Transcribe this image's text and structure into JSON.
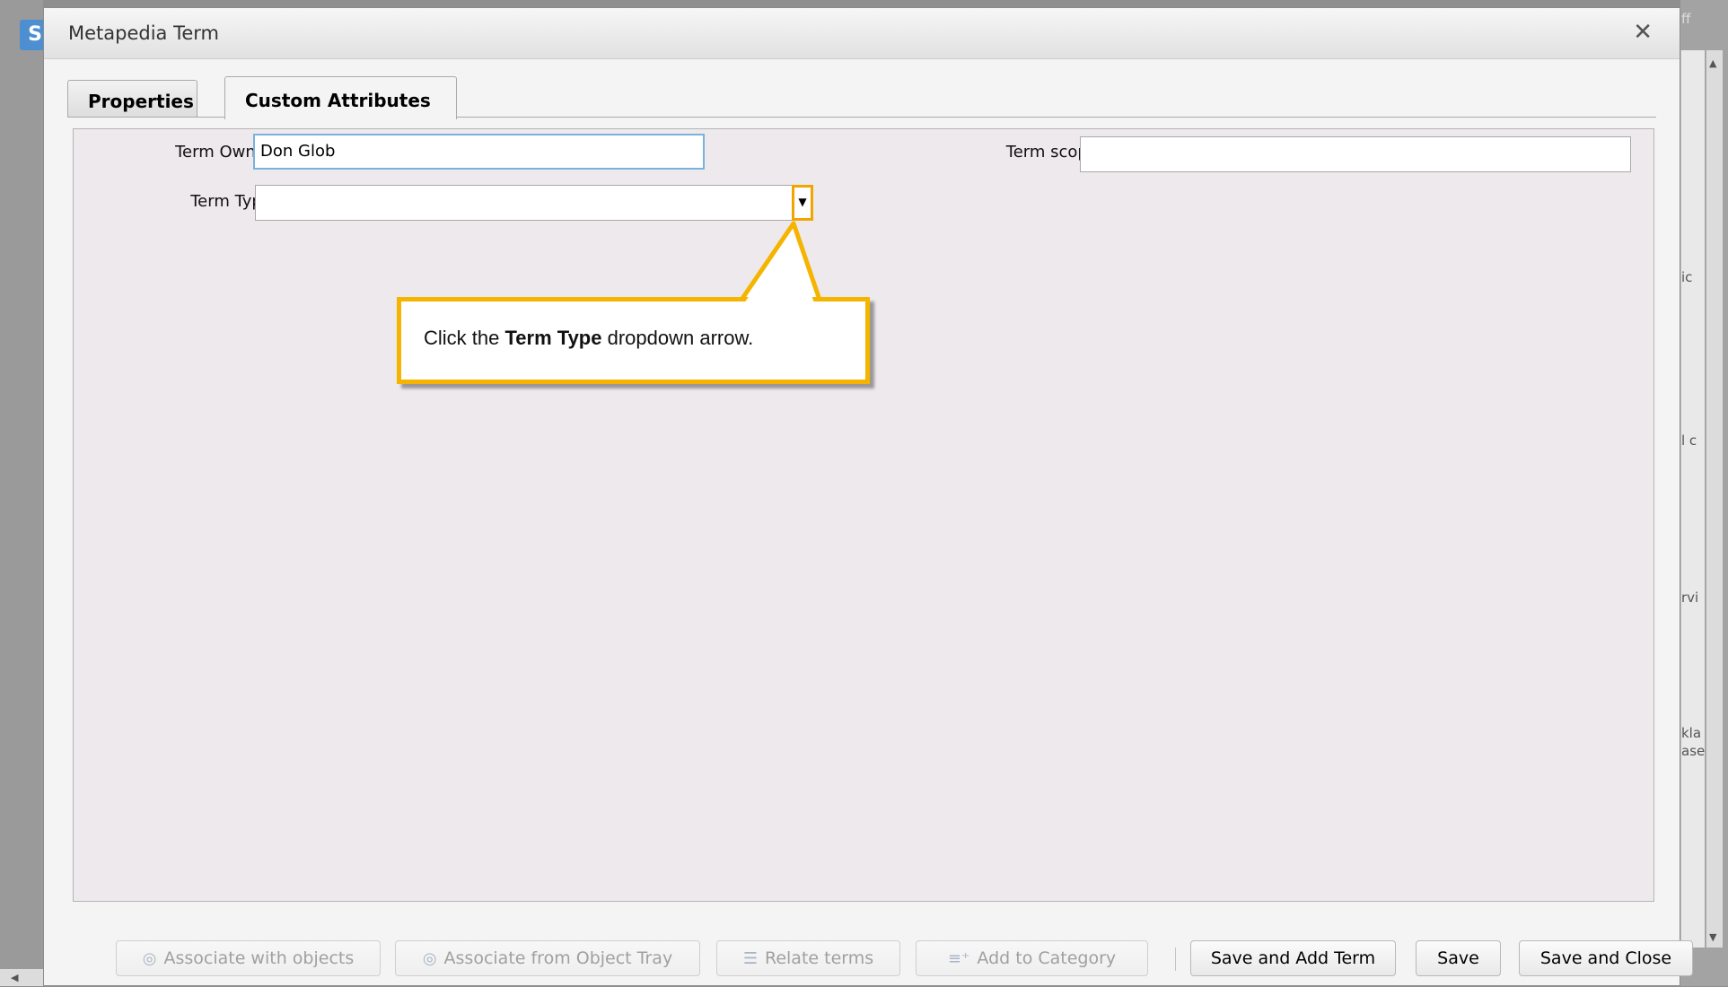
{
  "dialog": {
    "title": "Metapedia Term",
    "close_glyph": "✕"
  },
  "tabs": [
    {
      "label": "Properties",
      "active": false
    },
    {
      "label": "Custom Attributes",
      "active": true
    }
  ],
  "form": {
    "term_owner_label": "Term Owner:",
    "term_owner_value": "Don Glob",
    "term_type_label": "Term Type:",
    "term_type_value": "",
    "term_scope_label": "Term scope:",
    "term_scope_value": ""
  },
  "callout": {
    "prefix": "Click the ",
    "bold": "Term Type",
    "suffix": " dropdown arrow."
  },
  "footer": {
    "associate_with_objects": "Associate with objects",
    "associate_from_tray": "Associate from Object Tray",
    "relate_terms": "Relate terms",
    "add_to_category": "Add to Category",
    "save_and_add_term": "Save and Add Term",
    "save": "Save",
    "save_and_close": "Save and Close"
  },
  "background": {
    "logo_letter": "S",
    "right_fragments": [
      "ff",
      "ic",
      "l c",
      "rvi",
      "kla",
      "ase"
    ]
  },
  "colors": {
    "accent_callout": "#f5b400",
    "focus_border": "#7ab2de",
    "panel_bg": "#ede9ec"
  }
}
